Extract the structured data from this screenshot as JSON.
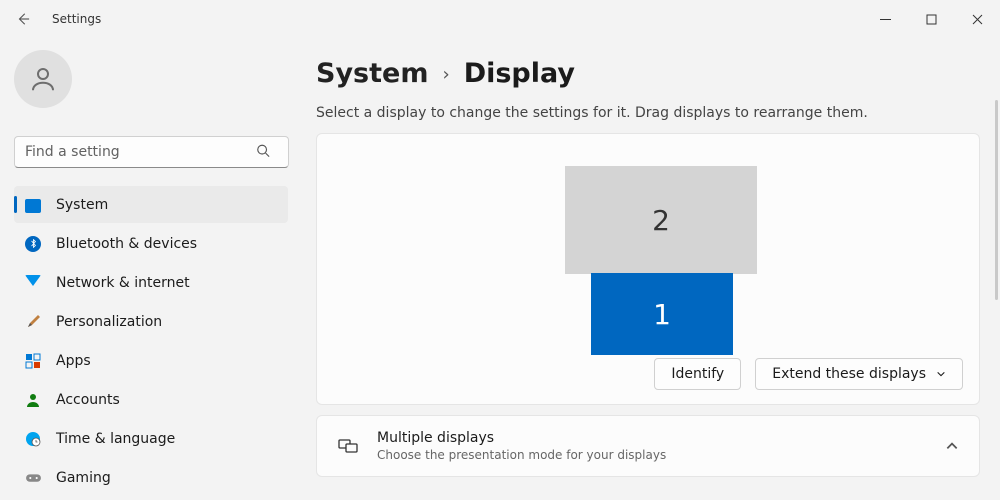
{
  "titlebar": {
    "title": "Settings"
  },
  "search": {
    "placeholder": "Find a setting"
  },
  "sidebar": {
    "items": [
      {
        "label": "System"
      },
      {
        "label": "Bluetooth & devices"
      },
      {
        "label": "Network & internet"
      },
      {
        "label": "Personalization"
      },
      {
        "label": "Apps"
      },
      {
        "label": "Accounts"
      },
      {
        "label": "Time & language"
      },
      {
        "label": "Gaming"
      }
    ]
  },
  "breadcrumb": {
    "parent": "System",
    "current": "Display"
  },
  "display": {
    "hint": "Select a display to change the settings for it. Drag displays to rearrange them.",
    "monitors": {
      "primary": "1",
      "secondary": "2"
    },
    "identify_label": "Identify",
    "mode_label": "Extend these displays",
    "multi_title": "Multiple displays",
    "multi_sub": "Choose the presentation mode for your displays"
  }
}
